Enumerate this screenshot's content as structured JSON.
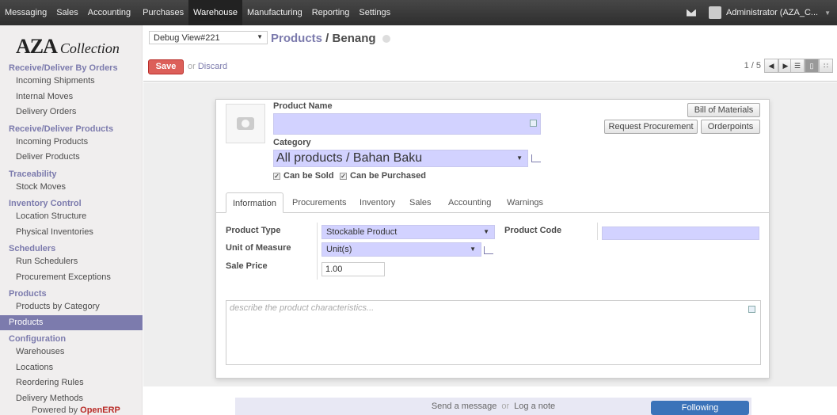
{
  "topbar": {
    "menu": [
      "Messaging",
      "Sales",
      "Accounting",
      "Purchases",
      "Warehouse",
      "Manufacturing",
      "Reporting",
      "Settings"
    ],
    "active_menu": "Warehouse",
    "user": "Administrator (AZA_C..."
  },
  "sidebar": {
    "logo_main": "AZA",
    "logo_sub": "Collection",
    "sections": [
      {
        "title": "Receive/Deliver By Orders",
        "items": [
          "Incoming Shipments",
          "Internal Moves",
          "Delivery Orders"
        ]
      },
      {
        "title": "Receive/Deliver Products",
        "items": [
          "Incoming Products",
          "Deliver Products"
        ]
      },
      {
        "title": "Traceability",
        "items": [
          "Stock Moves"
        ]
      },
      {
        "title": "Inventory Control",
        "items": [
          "Location Structure",
          "Physical Inventories"
        ]
      },
      {
        "title": "Schedulers",
        "items": [
          "Run Schedulers",
          "Procurement Exceptions"
        ]
      },
      {
        "title": "Products",
        "items": [
          "Products by Category",
          "Products"
        ]
      },
      {
        "title": "Configuration",
        "items": [
          "Warehouses",
          "Locations",
          "Reordering Rules",
          "Delivery Methods"
        ]
      }
    ],
    "active_item": "Products",
    "powered_prefix": "Powered by",
    "powered_brand": "OpenERP"
  },
  "control": {
    "debug_select": "Debug View#221",
    "breadcrumb_parent": "Products",
    "breadcrumb_sep": " / ",
    "breadcrumb_current": "Benang",
    "save_label": "Save",
    "or_text": "or",
    "discard_label": "Discard",
    "pager_text": "1 / 5"
  },
  "form": {
    "product_name_label": "Product Name",
    "product_name_value": "",
    "category_label": "Category",
    "category_value": "All products /  Bahan Baku",
    "can_be_sold": "Can be Sold",
    "can_be_purchased": "Can be Purchased",
    "btn_bom": "Bill of Materials",
    "btn_procurement": "Request Procurement",
    "btn_orderpoints": "Orderpoints",
    "tabs": [
      "Information",
      "Procurements",
      "Inventory",
      "Sales",
      "Accounting",
      "Warnings"
    ],
    "product_type_label": "Product Type",
    "product_type_value": "Stockable Product",
    "uom_label": "Unit of Measure",
    "uom_value": "Unit(s)",
    "sale_price_label": "Sale Price",
    "sale_price_value": "1.00",
    "product_code_label": "Product Code",
    "product_code_value": "",
    "description_placeholder": "describe the product characteristics..."
  },
  "chatter": {
    "send_message": "Send a message",
    "or_text": "or",
    "log_note": "Log a note",
    "following": "Following"
  }
}
